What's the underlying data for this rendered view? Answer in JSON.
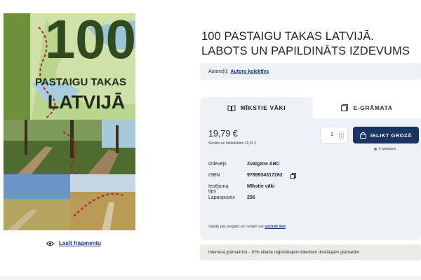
{
  "cover": {
    "big_number": "100",
    "subtitle": "PASTAIGU TAKAS",
    "country": "LATVIJĀ"
  },
  "read_fragment": {
    "label": "Lasīt fragmentu",
    "icon": "eye-icon"
  },
  "book": {
    "title": "100 PASTAIGU TAKAS LATVIJĀ. LABOTS UN PAPILDINĀTS IZDEVUMS",
    "author_label": "Autors(i):",
    "author_name": "Autoru kolektīvs"
  },
  "tabs": [
    {
      "label": "MĪKSTIE VĀKI",
      "icon": "book-icon",
      "active": true
    },
    {
      "label": "E-GRĀMATA",
      "icon": "tablet-icon",
      "active": false
    }
  ],
  "purchase": {
    "price": "19,79 €",
    "school_price": "Skolām un bibliotēkām 15,23 €",
    "quantity": "1",
    "cart_button": "IELIKT GROZĀ",
    "cart_icon": "lock-bag-icon",
    "stock": "Ir pieejams",
    "stock_color": "#43a55c"
  },
  "details": [
    {
      "label": "Izdevējs",
      "value": "Zvaigzne ABC"
    },
    {
      "label": "ISBN",
      "value": "9789934317262"
    },
    {
      "label": "Iesējuma tips",
      "value": "Mīkstie vāki"
    },
    {
      "label": "Lapaspuses",
      "value": "256"
    }
  ],
  "delivery": {
    "text": "Vairāk par piegādi un cenām var",
    "link": "uzzināt šeit",
    "end": "."
  },
  "promo": "Interneta grāmatnīcā - 10% atlaide reģistrētajiem klientiem drukātajām grāmatām",
  "colors": {
    "accent": "#1b3563",
    "panel": "#eef1f5",
    "promo_bg": "#eaede5"
  }
}
